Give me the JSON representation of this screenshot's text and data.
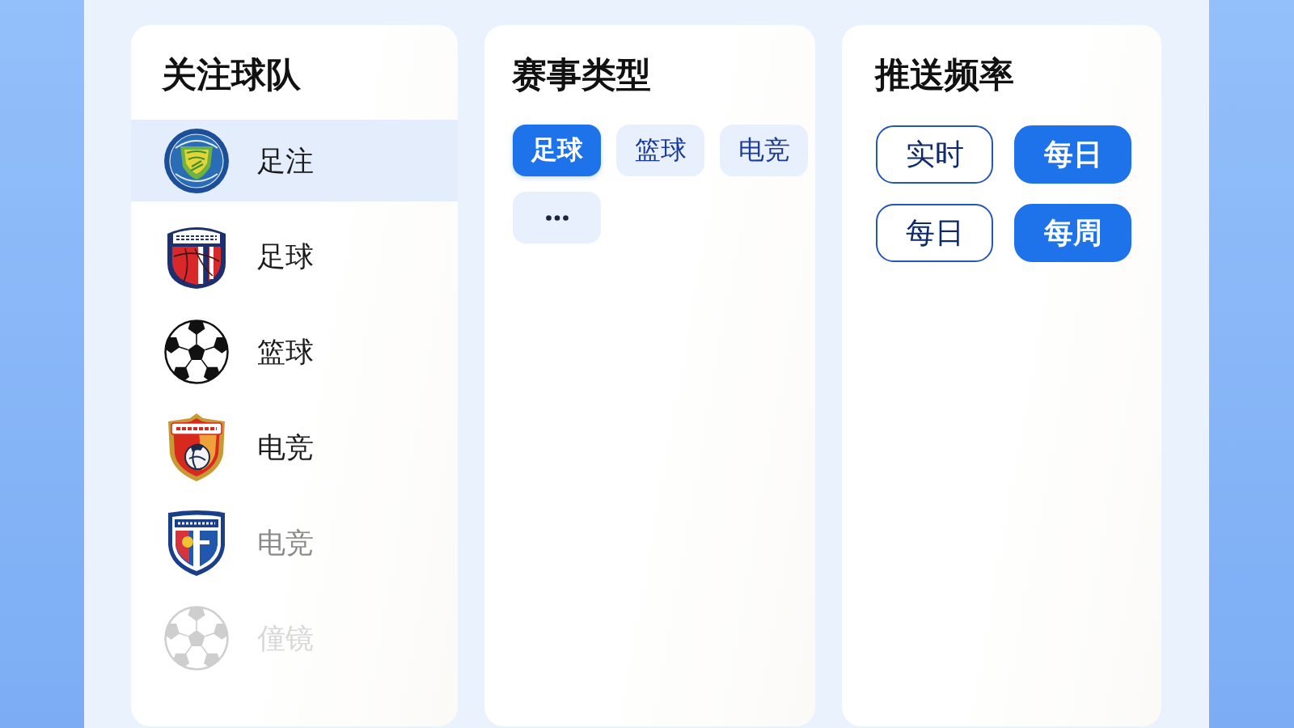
{
  "teams_card": {
    "title": "关注球队",
    "teams": [
      {
        "name": "足注",
        "kind": "round-badge",
        "selected": true,
        "muted": false,
        "faded": false
      },
      {
        "name": "足球",
        "kind": "striped-badge",
        "selected": false,
        "muted": false,
        "faded": false
      },
      {
        "name": "篮球",
        "kind": "ball",
        "selected": false,
        "muted": false,
        "faded": false
      },
      {
        "name": "电竞",
        "kind": "flame-shield",
        "selected": false,
        "muted": false,
        "faded": false
      },
      {
        "name": "电竞",
        "kind": "cross-shield",
        "selected": false,
        "muted": true,
        "faded": false
      },
      {
        "name": "僮镜",
        "kind": "ball",
        "selected": false,
        "muted": false,
        "faded": true
      }
    ]
  },
  "event_types_card": {
    "title": "赛事类型",
    "chips": [
      {
        "kind": "label",
        "label": "足球",
        "selected": true
      },
      {
        "kind": "label",
        "label": "篮球",
        "selected": false
      },
      {
        "kind": "label",
        "label": "电竞",
        "selected": false
      },
      {
        "kind": "more",
        "selected": false
      }
    ]
  },
  "push_frequency_card": {
    "title": "推送频率",
    "options": [
      {
        "label": "实时",
        "selected": false
      },
      {
        "label": "每日",
        "selected": true
      },
      {
        "label": "每日",
        "selected": false
      },
      {
        "label": "每周",
        "selected": true
      }
    ]
  }
}
